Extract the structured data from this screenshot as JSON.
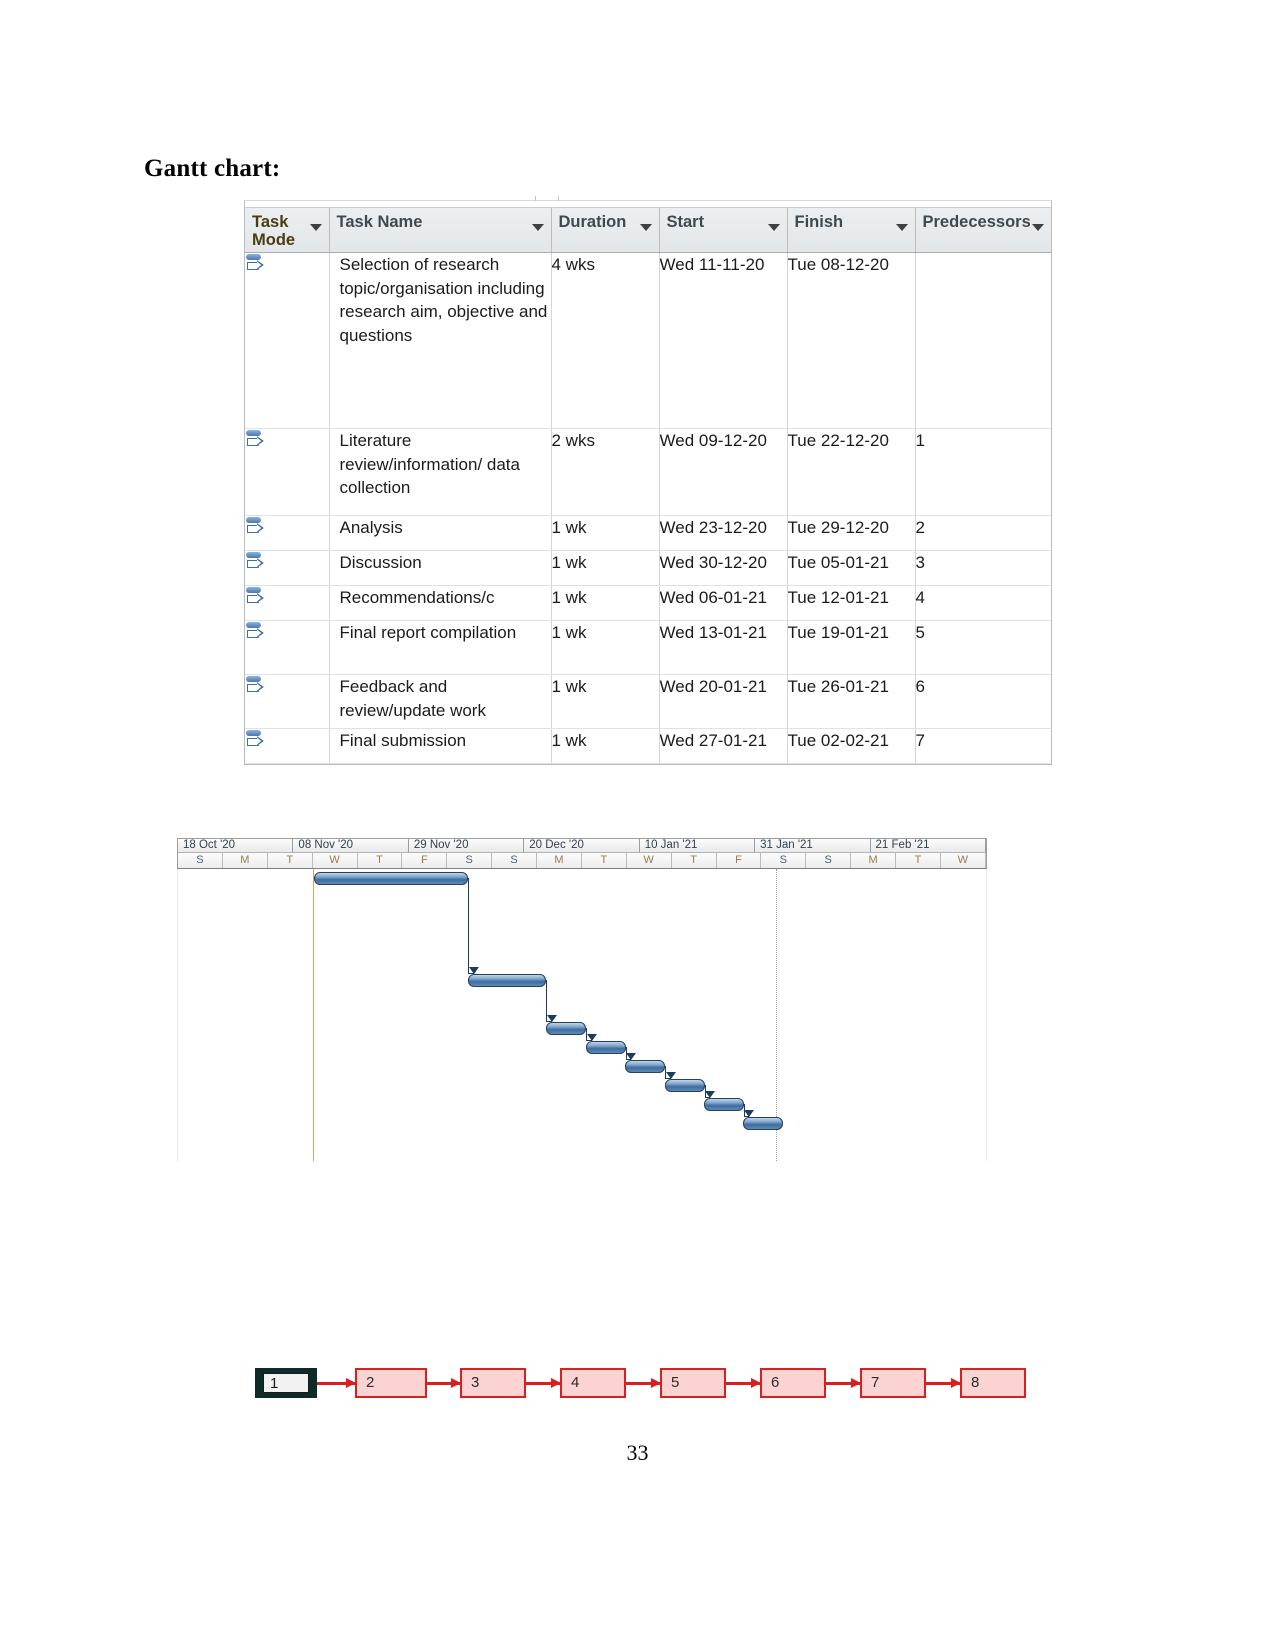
{
  "document": {
    "heading": "Gantt chart:",
    "page_number": "33"
  },
  "project_table": {
    "columns": [
      {
        "key": "task_mode",
        "label": "Task Mode",
        "label_line1": "Task",
        "label_line2": "Mode"
      },
      {
        "key": "task_name",
        "label": "Task Name"
      },
      {
        "key": "duration",
        "label": "Duration"
      },
      {
        "key": "start",
        "label": "Start"
      },
      {
        "key": "finish",
        "label": "Finish"
      },
      {
        "key": "predecessors",
        "label": "Predecessors"
      }
    ],
    "rows": [
      {
        "id": 1,
        "mode_icon": "manually-scheduled-icon",
        "task_name": "Selection of research topic/organisation including research aim, objective and questions",
        "duration": "4 wks",
        "start": "Wed 11-11-20",
        "finish": "Tue 08-12-20",
        "predecessors": ""
      },
      {
        "id": 2,
        "mode_icon": "manually-scheduled-icon",
        "task_name": "Literature review/information/ data collection",
        "duration": "2 wks",
        "start": "Wed 09-12-20",
        "finish": "Tue 22-12-20",
        "predecessors": "1"
      },
      {
        "id": 3,
        "mode_icon": "manually-scheduled-icon",
        "task_name": "Analysis",
        "duration": "1 wk",
        "start": "Wed 23-12-20",
        "finish": "Tue 29-12-20",
        "predecessors": "2"
      },
      {
        "id": 4,
        "mode_icon": "manually-scheduled-icon",
        "task_name": "Discussion",
        "duration": "1 wk",
        "start": "Wed 30-12-20",
        "finish": "Tue 05-01-21",
        "predecessors": "3"
      },
      {
        "id": 5,
        "mode_icon": "manually-scheduled-icon",
        "task_name": "Recommendations/c",
        "duration": "1 wk",
        "start": "Wed 06-01-21",
        "finish": "Tue 12-01-21",
        "predecessors": "4"
      },
      {
        "id": 6,
        "mode_icon": "manually-scheduled-icon",
        "task_name": "Final report compilation",
        "duration": "1 wk",
        "start": "Wed 13-01-21",
        "finish": "Tue 19-01-21",
        "predecessors": "5"
      },
      {
        "id": 7,
        "mode_icon": "manually-scheduled-icon",
        "task_name": "Feedback and review/update work",
        "duration": "1 wk",
        "start": "Wed 20-01-21",
        "finish": "Tue 26-01-21",
        "predecessors": "6"
      },
      {
        "id": 8,
        "mode_icon": "manually-scheduled-icon",
        "task_name": "Final submission",
        "duration": "1 wk",
        "start": "Wed 27-01-21",
        "finish": "Tue 02-02-21",
        "predecessors": "7"
      }
    ]
  },
  "chart_data": {
    "type": "bar",
    "title": "Gantt chart",
    "xlabel": "",
    "ylabel": "",
    "timescale": {
      "major_ticks": [
        "18 Oct '20",
        "08 Nov '20",
        "29 Nov '20",
        "20 Dec '20",
        "10 Jan '21",
        "31 Jan '21",
        "21 Feb '21"
      ],
      "minor_ticks": [
        "S",
        "M",
        "T",
        "W",
        "T",
        "F",
        "S",
        "S",
        "M",
        "T",
        "W",
        "T",
        "F",
        "S",
        "S",
        "M",
        "T",
        "W"
      ],
      "x_start": "2020-10-18",
      "x_end": "2021-02-27",
      "unit": "week"
    },
    "bars": [
      {
        "task": "Selection of research topic/organisation including research aim, objective and questions",
        "start": "Wed 11-11-20",
        "finish": "Tue 08-12-20",
        "duration_weeks": 4,
        "row": 1
      },
      {
        "task": "Literature review/information/ data collection",
        "start": "Wed 09-12-20",
        "finish": "Tue 22-12-20",
        "duration_weeks": 2,
        "row": 2
      },
      {
        "task": "Analysis",
        "start": "Wed 23-12-20",
        "finish": "Tue 29-12-20",
        "duration_weeks": 1,
        "row": 3
      },
      {
        "task": "Discussion",
        "start": "Wed 30-12-20",
        "finish": "Tue 05-01-21",
        "duration_weeks": 1,
        "row": 4
      },
      {
        "task": "Recommendations/c",
        "start": "Wed 06-01-21",
        "finish": "Tue 12-01-21",
        "duration_weeks": 1,
        "row": 5
      },
      {
        "task": "Final report compilation",
        "start": "Wed 13-01-21",
        "finish": "Tue 19-01-21",
        "duration_weeks": 1,
        "row": 6
      },
      {
        "task": "Feedback and review/update work",
        "start": "Wed 20-01-21",
        "finish": "Tue 26-01-21",
        "duration_weeks": 1,
        "row": 7
      },
      {
        "task": "Final submission",
        "start": "Wed 27-01-21",
        "finish": "Tue 02-02-21",
        "duration_weeks": 1,
        "row": 8
      }
    ],
    "dependencies": [
      {
        "from": 1,
        "to": 2,
        "type": "finish-to-start"
      },
      {
        "from": 2,
        "to": 3,
        "type": "finish-to-start"
      },
      {
        "from": 3,
        "to": 4,
        "type": "finish-to-start"
      },
      {
        "from": 4,
        "to": 5,
        "type": "finish-to-start"
      },
      {
        "from": 5,
        "to": 6,
        "type": "finish-to-start"
      },
      {
        "from": 6,
        "to": 7,
        "type": "finish-to-start"
      },
      {
        "from": 7,
        "to": 8,
        "type": "finish-to-start"
      }
    ],
    "colors": {
      "bar_fill": "#4a7bb0",
      "bar_border": "#27415c",
      "link": "#1f3b5c",
      "project_start_line": "#d8a463",
      "status_line": "#9a9a9a"
    },
    "grid": false,
    "legend": "none"
  },
  "network_diagram": {
    "nodes": [
      {
        "label": "1",
        "critical": true
      },
      {
        "label": "2",
        "critical": false
      },
      {
        "label": "3",
        "critical": false
      },
      {
        "label": "4",
        "critical": false
      },
      {
        "label": "5",
        "critical": false
      },
      {
        "label": "6",
        "critical": false
      },
      {
        "label": "7",
        "critical": false
      },
      {
        "label": "8",
        "critical": false
      }
    ],
    "colors": {
      "node_fill": "#fbd3d3",
      "node_border": "#d72020",
      "link": "#d72020",
      "critical_frame": "#0d2b2b"
    }
  }
}
